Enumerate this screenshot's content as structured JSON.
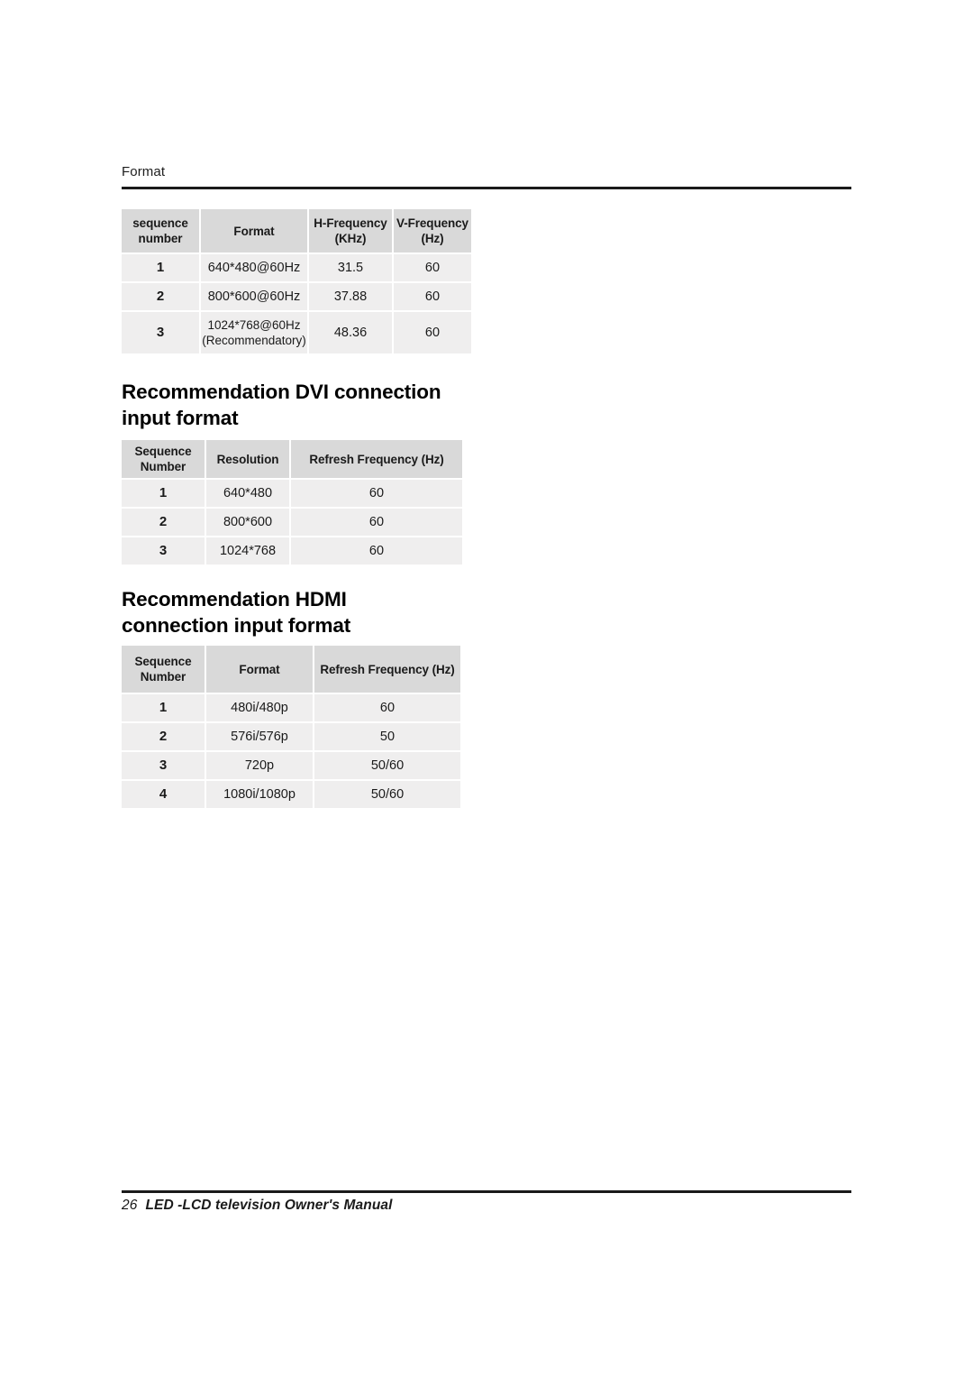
{
  "header": {
    "running_head": "Format"
  },
  "sections": [
    {
      "id": "format",
      "heading": "",
      "table": {
        "headers": [
          "sequence\nnumber",
          "Format",
          "H-Frequency\n(KHz)",
          "V-Frequency\n(Hz)"
        ],
        "rows": [
          {
            "seq": "1",
            "format": "640*480@60Hz",
            "h_freq": "31.5",
            "v_freq": "60"
          },
          {
            "seq": "2",
            "format": "800*600@60Hz",
            "h_freq": "37.88",
            "v_freq": "60"
          },
          {
            "seq": "3",
            "format": "1024*768@60Hz\n(Recommendatory)",
            "h_freq": "48.36",
            "v_freq": "60"
          }
        ]
      }
    },
    {
      "id": "dvi",
      "heading": "Recommendation DVI connection\ninput format",
      "table": {
        "headers": [
          "Sequence\nNumber",
          "Resolution",
          "Refresh Frequency (Hz)"
        ],
        "rows": [
          {
            "seq": "1",
            "resolution": "640*480",
            "refresh": "60"
          },
          {
            "seq": "2",
            "resolution": "800*600",
            "refresh": "60"
          },
          {
            "seq": "3",
            "resolution": "1024*768",
            "refresh": "60"
          }
        ]
      }
    },
    {
      "id": "hdmi",
      "heading": "Recommendation HDMI\nconnection input format",
      "table": {
        "headers": [
          "Sequence\nNumber",
          "Format",
          "Refresh Frequency (Hz)"
        ],
        "rows": [
          {
            "seq": "1",
            "format": "480i/480p",
            "refresh": "60"
          },
          {
            "seq": "2",
            "format": "576i/576p",
            "refresh": "50"
          },
          {
            "seq": "3",
            "format": "720p",
            "refresh": "50/60"
          },
          {
            "seq": "4",
            "format": "1080i/1080p",
            "refresh": "50/60"
          }
        ]
      }
    }
  ],
  "footer": {
    "page_number": "26",
    "manual_title": "LED -LCD television Owner's Manual"
  },
  "colors": {
    "table_header_bg": "#d9d9d9",
    "table_cell_bg": "#efeeee",
    "rule": "#1a1a1a",
    "text": "#1a1a1a",
    "page_bg": "#ffffff"
  }
}
